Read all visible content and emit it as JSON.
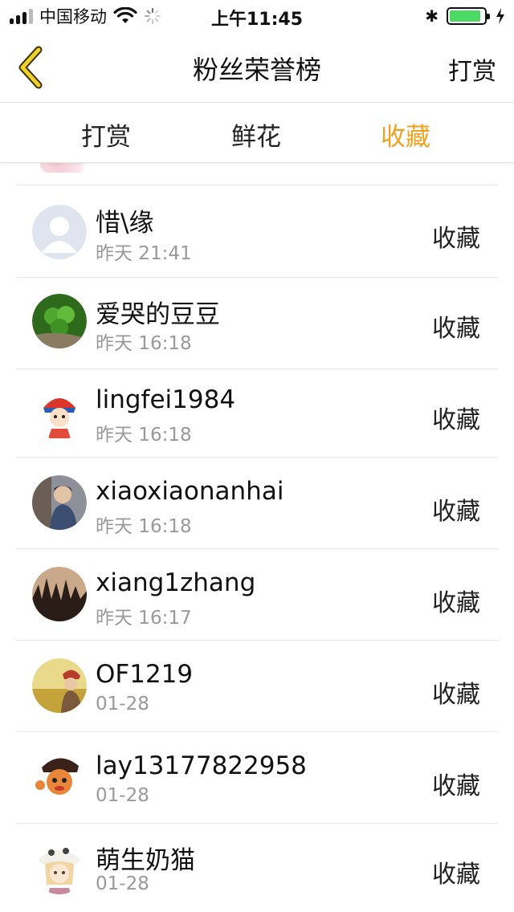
{
  "status_bar": {
    "carrier": "中国移动",
    "time": "上午11:45",
    "battery_level": 0.9,
    "battery_color": "#4cd964"
  },
  "nav": {
    "back_icon": "chevron-left-icon",
    "title": "粉丝荣誉榜",
    "action_label": "打赏",
    "accent_color": "#f0c41f"
  },
  "tabs": [
    {
      "label": "打赏",
      "active": false
    },
    {
      "label": "鲜花",
      "active": false
    },
    {
      "label": "收藏",
      "active": true
    }
  ],
  "tab_active_color": "#f0a21f",
  "list": [
    {
      "name": "惜\\缘",
      "time": "昨天 21:41",
      "action": "收藏",
      "avatar": "default-user-avatar"
    },
    {
      "name": "爱哭的豆豆",
      "time": "昨天 16:18",
      "action": "收藏",
      "avatar": "clover-photo-avatar"
    },
    {
      "name": "lingfei1984",
      "time": "昨天 16:18",
      "action": "收藏",
      "avatar": "cartoon-girl-avatar"
    },
    {
      "name": "xiaoxiaonanhai",
      "time": "昨天 16:18",
      "action": "收藏",
      "avatar": "young-man-photo-avatar"
    },
    {
      "name": "xiang1zhang",
      "time": "昨天 16:17",
      "action": "收藏",
      "avatar": "concert-crowd-avatar"
    },
    {
      "name": "OF1219",
      "time": "01-28",
      "action": "收藏",
      "avatar": "field-girl-photo-avatar"
    },
    {
      "name": "lay13177822958",
      "time": "01-28",
      "action": "收藏",
      "avatar": "cartoon-boy-hat-avatar"
    },
    {
      "name": "萌生奶猫",
      "time": "01-28",
      "action": "收藏",
      "avatar": "anime-girl-cat-hat-avatar"
    }
  ]
}
